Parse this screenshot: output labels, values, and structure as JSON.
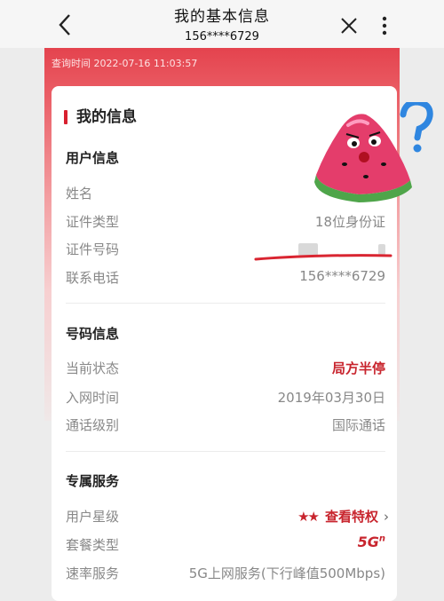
{
  "header": {
    "title": "我的基本信息",
    "subtitle": "156****6729",
    "back_icon": "chevron-left-icon",
    "close_icon": "close-icon",
    "more_icon": "more-vertical-icon"
  },
  "query_time": "查询时间 2022-07-16 11:03:57",
  "section_title": "我的信息",
  "user_info": {
    "title": "用户信息",
    "rows": [
      {
        "label": "姓名",
        "value": ""
      },
      {
        "label": "证件类型",
        "value": "18位身份证"
      },
      {
        "label": "证件号码",
        "value": ""
      },
      {
        "label": "联系电话",
        "value": "156****6729"
      }
    ]
  },
  "number_info": {
    "title": "号码信息",
    "rows": [
      {
        "label": "当前状态",
        "value": "局方半停"
      },
      {
        "label": "入网时间",
        "value": "2019年03月30日"
      },
      {
        "label": "通话级别",
        "value": "国际通话"
      }
    ]
  },
  "exclusive_service": {
    "title": "专属服务",
    "rows": [
      {
        "label": "用户星级",
        "value": "查看特权",
        "stars": "★★"
      },
      {
        "label": "套餐类型",
        "value": "5G",
        "sup": "n"
      },
      {
        "label": "速率服务",
        "value": "5G上网服务(下行峰值500Mbps)"
      }
    ]
  },
  "colors": {
    "accent": "#c8252e",
    "banner": "#e4434e"
  }
}
